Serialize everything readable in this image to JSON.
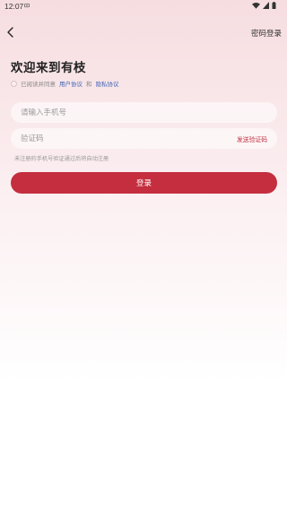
{
  "status_bar": {
    "time": "12:07"
  },
  "topbar": {
    "back_icon": "chevron-left-icon",
    "password_login": "密码登录"
  },
  "welcome_title": "欢迎来到有枝",
  "agreement": {
    "prefix": "已阅读并同意",
    "user_agreement": "用户协议",
    "and": "和",
    "privacy_policy": "隐私协议"
  },
  "phone_input": {
    "placeholder": "请输入手机号",
    "value": ""
  },
  "code_input": {
    "placeholder": "验证码",
    "value": "",
    "send_label": "发送验证码"
  },
  "hint": "未注册的手机号验证通过后将自动注册",
  "login_button": "登录",
  "colors": {
    "primary": "#c42e3e",
    "link": "#3f63b5",
    "send_code": "#c0303f"
  }
}
